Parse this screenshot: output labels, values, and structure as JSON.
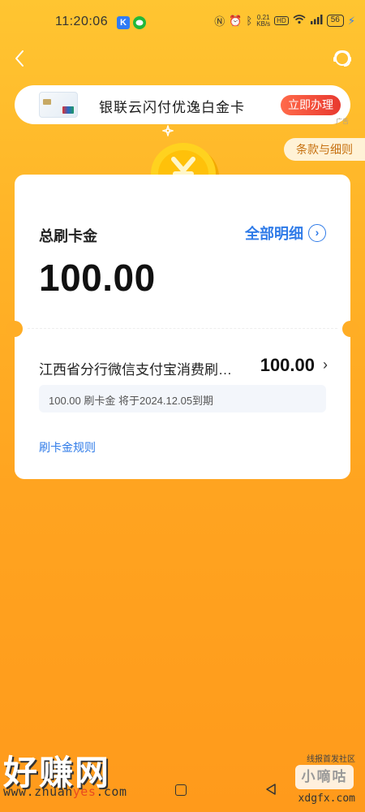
{
  "status_bar": {
    "time": "11:20:06",
    "app_badge_1": "K",
    "speed_value": "0.21",
    "speed_unit": "KB/s",
    "hd_label": "HD",
    "battery": "56"
  },
  "banner": {
    "text": "银联云闪付优逸白金卡",
    "button_label": "立即办理",
    "ad_label": "广告"
  },
  "terms_label": "条款与细则",
  "summary": {
    "label": "总刷卡金",
    "amount": "100.00",
    "detail_link": "全部明细"
  },
  "transaction": {
    "name": "江西省分行微信支付宝消费刷…",
    "amount": "100.00",
    "sub_text": "100.00 刷卡金 将于2024.12.05到期"
  },
  "rules_link": "刷卡金规则",
  "watermarks": {
    "left_logo": "好赚网",
    "left_url_prefix": "www.zhuan",
    "left_url_highlight": "yes",
    "left_url_suffix": ".com",
    "right_top": "线报首发社区",
    "right_logo": "小嘀咕",
    "right_url": "xdgfx.com"
  },
  "colors": {
    "background": "#ffb327",
    "accent_blue": "#2f7be8",
    "banner_button": "#e8392f",
    "coin": "#ffd21f"
  }
}
